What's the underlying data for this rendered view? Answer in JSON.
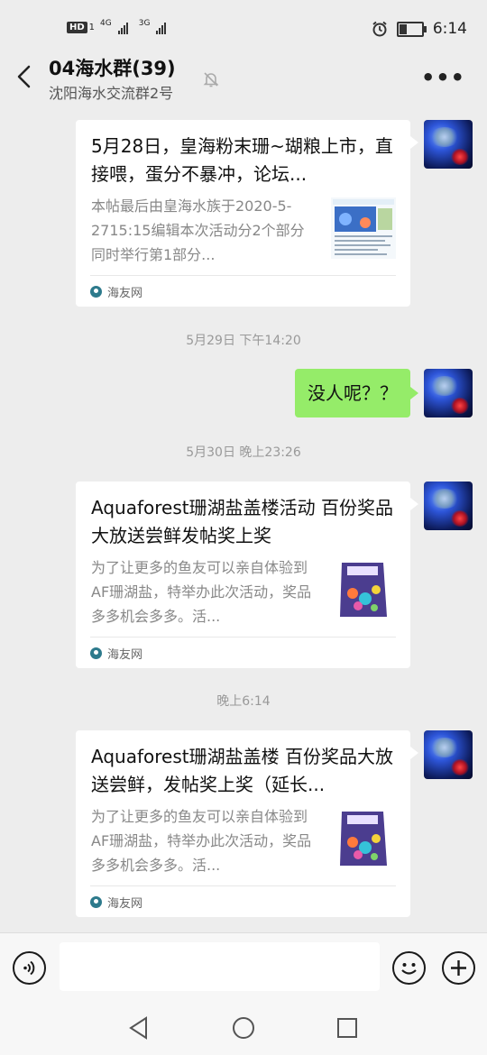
{
  "status": {
    "network_left": "4G",
    "network_right": "3G",
    "hd": "HD",
    "sim": "1",
    "time": "6:14",
    "battery_level": 0.35
  },
  "header": {
    "title": "04海水群(39)",
    "subtitle": "沈阳海水交流群2号"
  },
  "messages": [
    {
      "title": "5月28日，皇海粉末珊~瑚粮上市，直接喂，蛋分不暴冲，论坛...",
      "desc": "本帖最后由皇海水族于2020-5-2715:15编辑本次活动分2个部分同时举行第1部分...",
      "source": "海友网"
    },
    {
      "time": "5月29日 下午14:20"
    },
    {
      "text": "没人呢？？"
    },
    {
      "time": "5月30日 晚上23:26"
    },
    {
      "title": "Aquaforest珊湖盐盖楼活动 百份奖品大放送尝鲜发帖奖上奖",
      "desc": "为了让更多的鱼友可以亲自体验到AF珊湖盐，特举办此次活动，奖品多多机会多多。活...",
      "source": "海友网"
    },
    {
      "time": "晚上6:14"
    },
    {
      "title": "Aquaforest珊湖盐盖楼 百份奖品大放送尝鲜，发帖奖上奖（延长...",
      "desc": "为了让更多的鱼友可以亲自体验到AF珊湖盐，特举办此次活动，奖品多多机会多多。活...",
      "source": "海友网"
    }
  ],
  "colors": {
    "own_bubble": "#95ec69",
    "background": "#ededed",
    "card": "#ffffff"
  }
}
